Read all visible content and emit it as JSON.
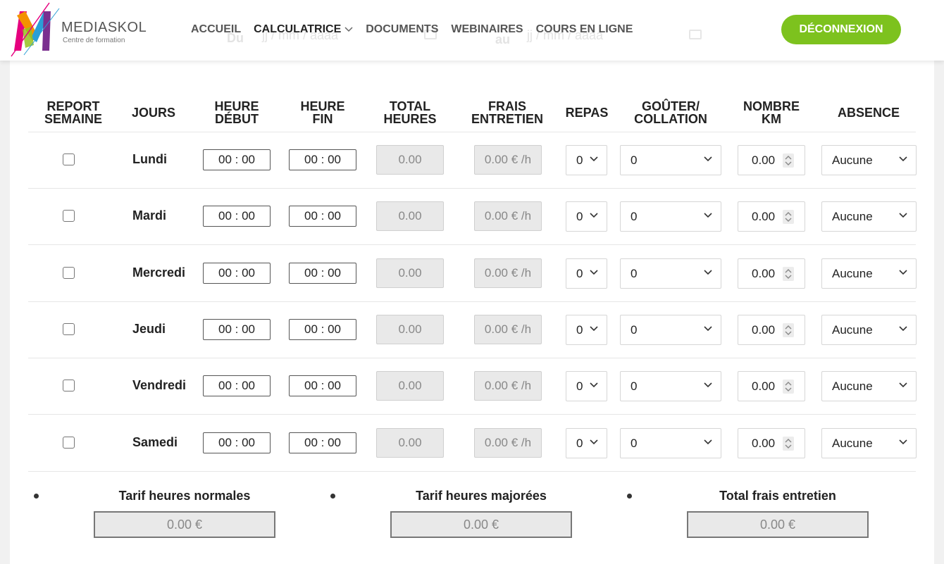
{
  "brand": {
    "name": "MEDIASKOL",
    "tagline": "Centre de formation"
  },
  "nav": [
    {
      "label": "ACCUEIL",
      "active": false
    },
    {
      "label": "CALCULATRICE",
      "active": true,
      "dropdown": true
    },
    {
      "label": "DOCUMENTS",
      "active": false
    },
    {
      "label": "WEBINAIRES",
      "active": false
    },
    {
      "label": "COURS EN LIGNE",
      "active": false
    }
  ],
  "logout_label": "DÉCONNEXION",
  "colors": {
    "accent": "#7dc21e",
    "readonly_bg": "#e9e9e9"
  },
  "date_filter": {
    "from_label": "Du",
    "to_label": "au",
    "placeholder": "jj / mm / aaaa"
  },
  "columns": [
    "REPORT\nSEMAINE",
    "JOURS",
    "HEURE\nDÉBUT",
    "HEURE\nFIN",
    "TOTAL\nHEURES",
    "FRAIS\nENTRETIEN",
    "REPAS",
    "GOÛTER/\nCOLLATION",
    "NOMBRE\nKM",
    "ABSENCE"
  ],
  "rows": [
    {
      "day": "Lundi",
      "start": "00 : 00",
      "end": "00 : 00",
      "total": "0.00",
      "frais": "0.00 € /h",
      "repas": "0",
      "gouter": "0",
      "km": "0.00",
      "absence": "Aucune"
    },
    {
      "day": "Mardi",
      "start": "00 : 00",
      "end": "00 : 00",
      "total": "0.00",
      "frais": "0.00 € /h",
      "repas": "0",
      "gouter": "0",
      "km": "0.00",
      "absence": "Aucune"
    },
    {
      "day": "Mercredi",
      "start": "00 : 00",
      "end": "00 : 00",
      "total": "0.00",
      "frais": "0.00 € /h",
      "repas": "0",
      "gouter": "0",
      "km": "0.00",
      "absence": "Aucune"
    },
    {
      "day": "Jeudi",
      "start": "00 : 00",
      "end": "00 : 00",
      "total": "0.00",
      "frais": "0.00 € /h",
      "repas": "0",
      "gouter": "0",
      "km": "0.00",
      "absence": "Aucune"
    },
    {
      "day": "Vendredi",
      "start": "00 : 00",
      "end": "00 : 00",
      "total": "0.00",
      "frais": "0.00 € /h",
      "repas": "0",
      "gouter": "0",
      "km": "0.00",
      "absence": "Aucune"
    },
    {
      "day": "Samedi",
      "start": "00 : 00",
      "end": "00 : 00",
      "total": "0.00",
      "frais": "0.00 € /h",
      "repas": "0",
      "gouter": "0",
      "km": "0.00",
      "absence": "Aucune"
    }
  ],
  "summary": [
    {
      "label": "Tarif heures normales",
      "value": "0.00 €"
    },
    {
      "label": "Tarif heures majorées",
      "value": "0.00 €"
    },
    {
      "label": "Total frais entretien",
      "value": "0.00 €"
    }
  ]
}
